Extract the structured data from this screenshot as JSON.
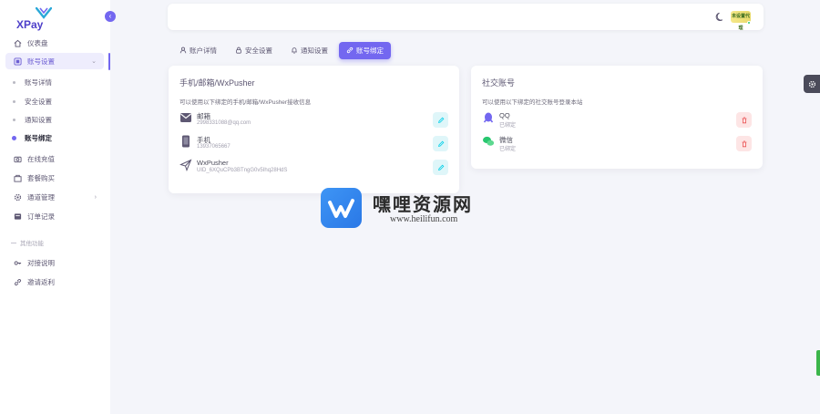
{
  "app": {
    "name": "XPay"
  },
  "sidebar": {
    "items": [
      {
        "label": "仪表盘",
        "icon": "home-icon"
      },
      {
        "label": "账号设置",
        "icon": "account-settings-icon",
        "expanded": true
      },
      {
        "label": "在线充值",
        "icon": "camera-icon"
      },
      {
        "label": "套餐购买",
        "icon": "package-icon"
      },
      {
        "label": "通道管理",
        "icon": "gear-icon"
      },
      {
        "label": "订单记录",
        "icon": "receipt-icon"
      }
    ],
    "sub_items": [
      {
        "label": "账号详情"
      },
      {
        "label": "安全设置"
      },
      {
        "label": "通知设置"
      },
      {
        "label": "账号绑定",
        "active": true
      }
    ],
    "section_label": "其他功能",
    "other_items": [
      {
        "label": "对接说明",
        "icon": "key-icon"
      },
      {
        "label": "邀请返利",
        "icon": "link-icon"
      }
    ]
  },
  "topbar": {
    "avatar_text": "未设置代理"
  },
  "tabs": [
    {
      "label": "账户详情",
      "icon": "user-icon"
    },
    {
      "label": "安全设置",
      "icon": "lock-icon"
    },
    {
      "label": "通知设置",
      "icon": "bell-icon"
    },
    {
      "label": "账号绑定",
      "icon": "link-icon",
      "active": true
    }
  ],
  "binding_card": {
    "title": "手机/邮箱/WxPusher",
    "description": "可以使用以下绑定的手机/邮箱/WxPusher接收信息",
    "rows": [
      {
        "name": "邮箱",
        "value": "2998331088@qq.com",
        "icon": "mail-icon"
      },
      {
        "name": "手机",
        "value": "13937065667",
        "icon": "phone-icon"
      },
      {
        "name": "WxPusher",
        "value": "UID_6XQuCPb3BTngG0v5Ihq28HdS",
        "icon": "send-icon"
      }
    ]
  },
  "social_card": {
    "title": "社交账号",
    "description": "可以使用以下绑定的社交账号登录本站",
    "rows": [
      {
        "name": "QQ",
        "value": "已绑定",
        "icon": "qq-icon"
      },
      {
        "name": "微信",
        "value": "已绑定",
        "icon": "wechat-icon"
      }
    ]
  },
  "watermark": {
    "title": "嘿哩资源网",
    "url": "www.heilifun.com"
  },
  "colors": {
    "accent": "#7367f0",
    "edit": "#00cfe8",
    "delete": "#ea5455"
  }
}
